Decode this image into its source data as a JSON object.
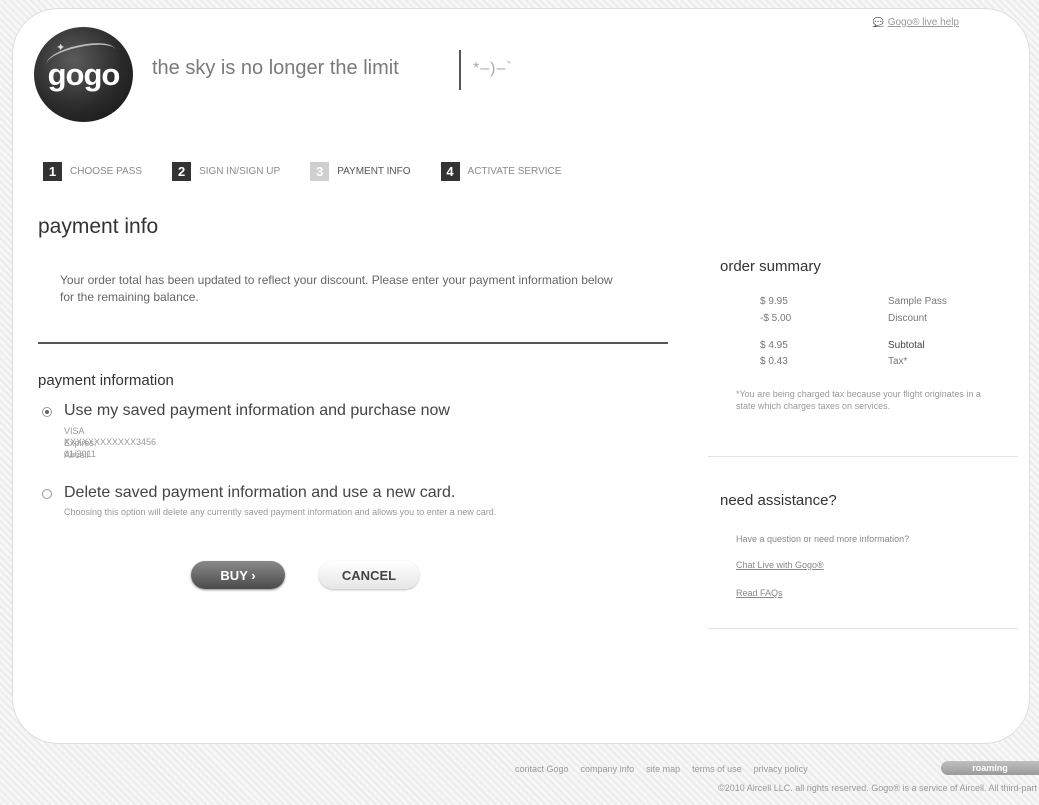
{
  "header": {
    "help_link": "Gogo® live help",
    "logo_text": "gogo",
    "tagline": "the sky is no longer the limit",
    "tagline_mark": "*–)–`"
  },
  "steps": [
    {
      "num": "1",
      "label": "CHOOSE PASS"
    },
    {
      "num": "2",
      "label": "SIGN IN/SIGN UP"
    },
    {
      "num": "3",
      "label": "PAYMENT INFO"
    },
    {
      "num": "4",
      "label": "ACTIVATE SERVICE"
    }
  ],
  "main": {
    "title": "payment info",
    "notice": "Your order total has been updated to reflect your discount. Please enter your payment information below for the remaining balance.",
    "section_title": "payment information",
    "option_saved": {
      "label": "Use my saved payment information and purchase now",
      "card_number": "VISA XXXXXXXXXXXX3456",
      "expires": "Expires: 01/2011",
      "name": "Aircell"
    },
    "option_new": {
      "label": "Delete saved payment information and use a new card.",
      "description": "Choosing this option will delete any currently saved payment information and allows you to enter a new card."
    },
    "buy_label": "BUY ›",
    "cancel_label": "CANCEL"
  },
  "order_summary": {
    "title": "order summary",
    "rows": [
      {
        "amount": "$ 9.95",
        "desc": "Sample Pass"
      },
      {
        "amount": "-$ 5.00",
        "desc": "Discount"
      },
      {
        "amount": "$ 4.95",
        "desc": "Subtotal"
      },
      {
        "amount": "$ 0.43",
        "desc": "Tax*"
      }
    ],
    "tax_note": "*You are being charged tax because your flight originates in a state which charges taxes on services."
  },
  "assistance": {
    "title": "need assistance?",
    "text": "Have a question or need more information?",
    "chat_link": "Chat Live with Gogo®",
    "faq_link": "Read FAQs"
  },
  "footer": {
    "links": [
      "contact Gogo",
      "company info",
      "site map",
      "terms of use",
      "privacy policy"
    ],
    "roaming": "roaming",
    "copyright": "©2010 Aircell LLC. all rights reserved. Gogo® is a service of Aircell. All third-part"
  }
}
